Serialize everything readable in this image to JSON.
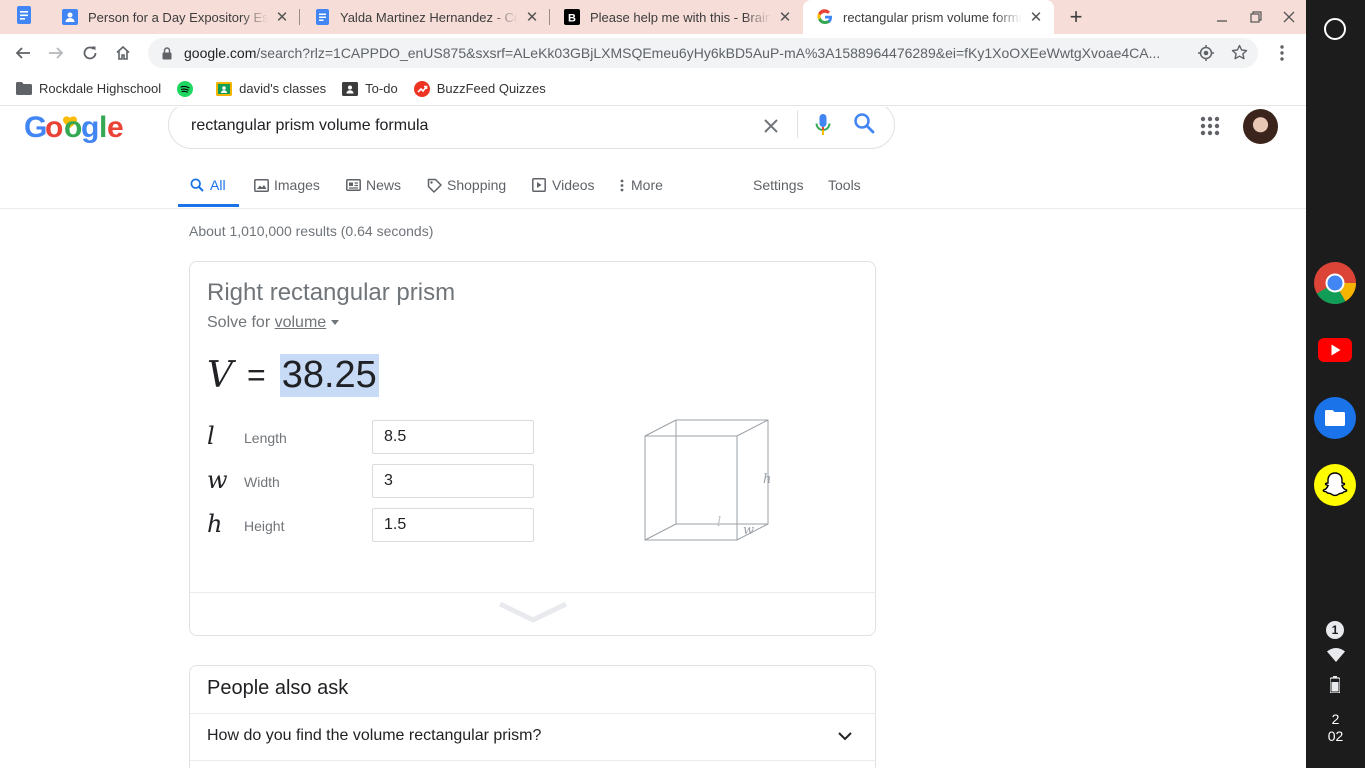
{
  "browser": {
    "tabs": [
      {
        "title": "",
        "icon": "google-docs-icon"
      },
      {
        "title": "Person for a Day Expository Essay",
        "icon": "google-classroom-icon"
      },
      {
        "title": "Yalda Martinez Hernandez - Copy of",
        "icon": "google-docs-icon"
      },
      {
        "title": "Please help me with this - Brainly.com",
        "icon": "brainly-icon"
      },
      {
        "title": "rectangular prism volume formula",
        "icon": "google-icon"
      }
    ],
    "url_host": "google.com",
    "url_path": "/search?rlz=1CAPPDO_enUS875&sxsrf=ALeKk03GBjLXMSQEmeu6yHy6kBD5AuP-mA%3A1588964476289&ei=fKy1XoOXEeWwtgXvoae4CA...",
    "bookmarks": [
      {
        "label": "Rockdale Highschool",
        "icon": "folder-icon"
      },
      {
        "label": "",
        "icon": "spotify-icon"
      },
      {
        "label": "david's classes",
        "icon": "classroom-icon"
      },
      {
        "label": "To-do",
        "icon": "todo-icon"
      },
      {
        "label": "BuzzFeed Quizzes",
        "icon": "buzzfeed-icon"
      }
    ]
  },
  "search": {
    "query": "rectangular prism volume formula",
    "nav": [
      {
        "label": "All",
        "icon": "search-icon",
        "active": true
      },
      {
        "label": "Images",
        "icon": "image-icon"
      },
      {
        "label": "News",
        "icon": "news-icon"
      },
      {
        "label": "Shopping",
        "icon": "tag-icon"
      },
      {
        "label": "Videos",
        "icon": "video-icon"
      },
      {
        "label": "More",
        "icon": "more-vert-icon"
      },
      {
        "label": "Settings"
      },
      {
        "label": "Tools"
      }
    ],
    "result_stats": "About 1,010,000 results (0.64 seconds)"
  },
  "calculator": {
    "title": "Right rectangular prism",
    "solve_prefix": "Solve for",
    "solve_target": "volume",
    "equation": {
      "variable": "V",
      "sign": "=",
      "value": "38.25"
    },
    "rows": [
      {
        "symbol": "l",
        "label": "Length",
        "value": "8.5"
      },
      {
        "symbol": "w",
        "label": "Width",
        "value": "3"
      },
      {
        "symbol": "h",
        "label": "Height",
        "value": "1.5"
      }
    ],
    "diagram_labels": {
      "h": "h",
      "l": "l",
      "w": "w"
    }
  },
  "paa": {
    "title": "People also ask",
    "questions": [
      "How do you find the volume rectangular prism?"
    ]
  },
  "shelf": {
    "notification_count": "1",
    "clock_hour": "2",
    "clock_minute": "02"
  },
  "colors": {
    "tabstrip": "#f6ddd8",
    "accent_blue": "#1a73e8",
    "highlight": "#c8dbf6",
    "shelf": "#1c1c1c"
  }
}
